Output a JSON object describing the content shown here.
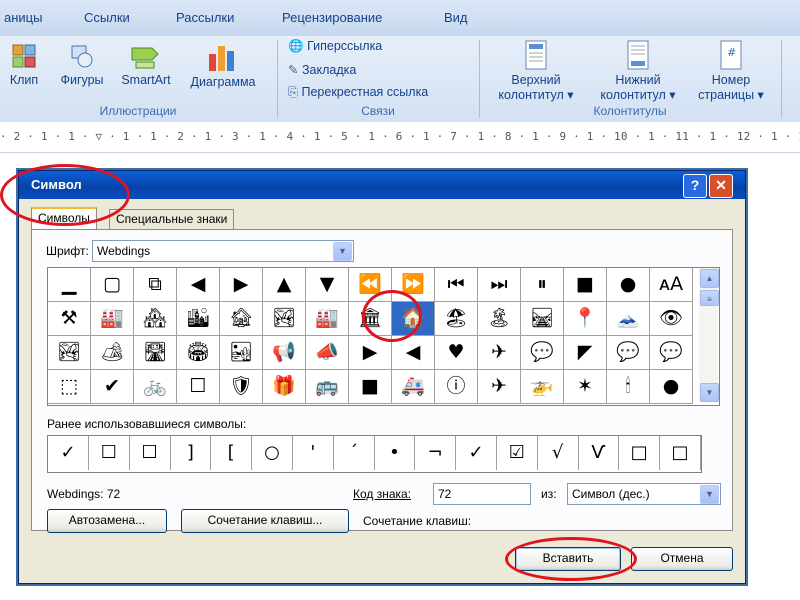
{
  "ribbon": {
    "tabs": [
      "аницы",
      "Ссылки",
      "Рассылки",
      "Рецензирование",
      "Вид"
    ],
    "illustrations": {
      "label": "Иллюстрации",
      "buttons": [
        "Клип",
        "Фигуры",
        "SmartArt",
        "Диаграмма"
      ]
    },
    "links": {
      "label": "Связи",
      "items": [
        "Гиперссылка",
        "Закладка",
        "Перекрестная ссылка"
      ]
    },
    "headers": {
      "label": "Колонтитулы",
      "buttons": [
        {
          "line1": "Верхний",
          "line2": "колонтитул"
        },
        {
          "line1": "Нижний",
          "line2": "колонтитул"
        },
        {
          "line1": "Номер",
          "line2": "страницы"
        }
      ]
    }
  },
  "ruler": {
    "text": "· 2 · 1 · 1 · ▽ · 1 · 1 · 2 · 1 · 3 · 1 · 4 · 1 · 5 · 1 · 6 · 1 · 7 · 1 · 8 · 1 · 9 · 1 · 10 · 1 · 11 · 1 · 12 · 1 · 13 · 1"
  },
  "dialog": {
    "title": "Символ",
    "help_icon": "?",
    "close_icon": "✕",
    "tabs": [
      "Символы",
      "Специальные знаки"
    ],
    "font_label": "Шрифт:",
    "font_value": "Webdings",
    "symbols": [
      [
        "▁",
        "▢",
        "⧉",
        "◀",
        "▶",
        "▲",
        "▼",
        "⏪",
        "⏩",
        "⏮",
        "⏭",
        "⏸",
        "■",
        "●",
        "ᴀA"
      ],
      [
        "⚒",
        "🏭",
        "🏘",
        "🏙",
        "🏚",
        "🏞",
        "🏭",
        "🏛",
        "🏠",
        "🏖",
        "🏝",
        "🛤",
        "📍",
        "🗻",
        "👁"
      ],
      [
        "🏞",
        "🏕",
        "🛣",
        "🏟",
        "🏜",
        "📢",
        "📣",
        "▶",
        "◀",
        "♥",
        "✈",
        "💬",
        "◤",
        "💬",
        "💬"
      ],
      [
        "⬚",
        "✔",
        "🚲",
        "☐",
        "🛡",
        "🎁",
        "🚌",
        "■",
        "🚑",
        "ⓘ",
        "✈",
        "🚁",
        "✶",
        "🕯",
        "●"
      ]
    ],
    "selected_symbol": {
      "row": 1,
      "col": 8
    },
    "recent_label": "Ранее использовавшиеся символы:",
    "recent": [
      "✓",
      "☐",
      "☐",
      "]",
      "[",
      "○",
      "'",
      "´",
      "•",
      "¬",
      "✓",
      "☑",
      "√",
      "Ѵ",
      "□",
      "□"
    ],
    "char_name": "Webdings: 72",
    "code_label": "Код знака:",
    "code_value": "72",
    "from_label": "из:",
    "from_value": "Символ (дес.)",
    "autocorrect_button": "Автозамена...",
    "shortcut_button": "Сочетание клавиш...",
    "shortcut_label": "Сочетание клавиш:",
    "insert_button": "Вставить",
    "cancel_button": "Отмена"
  },
  "colors": {
    "highlight": "#e0141c",
    "selection": "#316ac5",
    "titlebar": "#0a4cc0"
  }
}
